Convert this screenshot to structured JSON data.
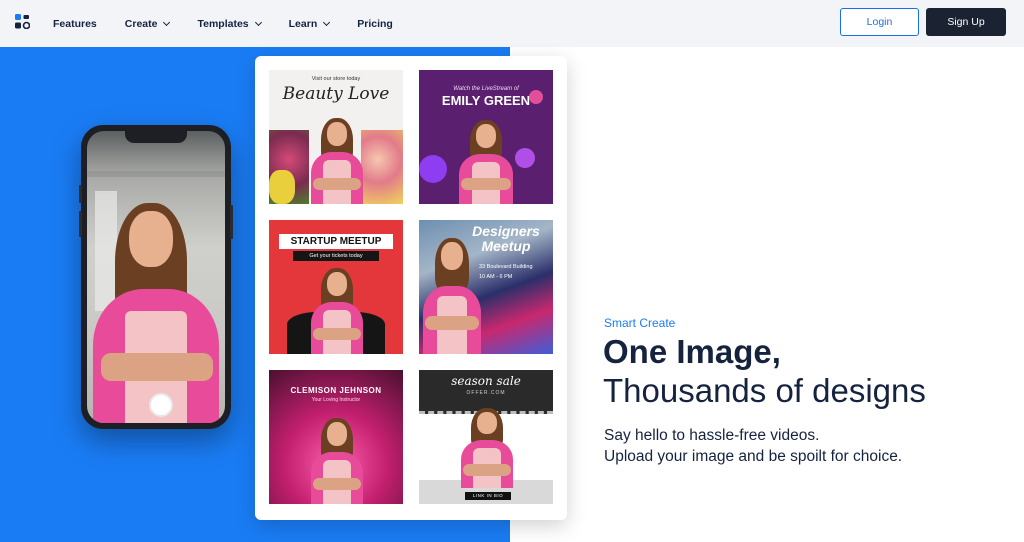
{
  "nav": {
    "items": [
      {
        "label": "Features",
        "dropdown": false
      },
      {
        "label": "Create",
        "dropdown": true
      },
      {
        "label": "Templates",
        "dropdown": true
      },
      {
        "label": "Learn",
        "dropdown": true
      },
      {
        "label": "Pricing",
        "dropdown": false
      }
    ],
    "login_label": "Login",
    "signup_label": "Sign Up"
  },
  "templates": [
    {
      "small": "Visit our store today",
      "title": "Beauty Love"
    },
    {
      "small": "Watch the LiveStream of",
      "title": "EMILY GREEN"
    },
    {
      "title": "STARTUP MEETUP",
      "small": "Get your tickets today"
    },
    {
      "title": "Designers Meetup",
      "small": "33 Boulevard Building",
      "small2": "10 AM - 6 PM"
    },
    {
      "title": "CLEMISON JEHNSON",
      "small": "Your Loving Instructor"
    },
    {
      "title": "season sale",
      "small": "OFFER.COM",
      "footer": "LINK IN BIO"
    }
  ],
  "hero": {
    "eyebrow": "Smart Create",
    "headline": "One Image,",
    "subheadline": "Thousands of designs",
    "description_line1": "Say hello to hassle-free videos.",
    "description_line2": "Upload your image and be spoilt for choice."
  },
  "colors": {
    "accent": "#1a7cf4",
    "dark": "#1b2232",
    "nav_bg": "#f2f4f8"
  }
}
